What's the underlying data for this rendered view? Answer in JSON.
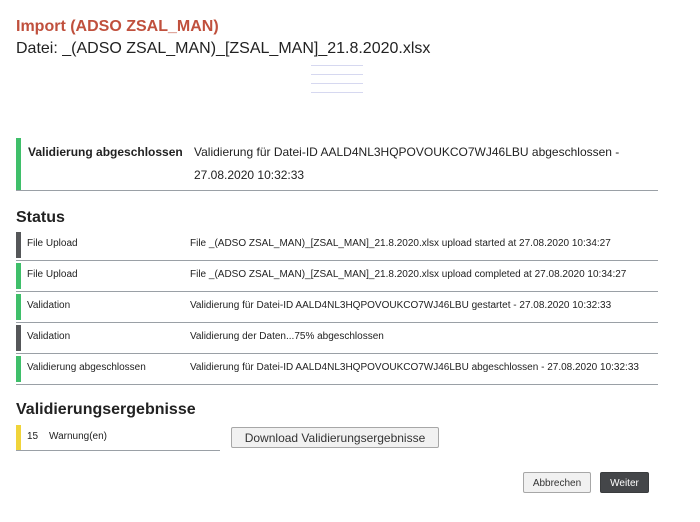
{
  "header": {
    "title": "Import  (ADSO ZSAL_MAN)",
    "filename": "Datei: _(ADSO ZSAL_MAN)_[ZSAL_MAN]_21.8.2020.xlsx"
  },
  "summary": {
    "label": "Validierung abgeschlossen",
    "message_line1": "Validierung für Datei-ID AALD4NL3HQPOVOUKCO7WJ46LBU abgeschlossen -",
    "message_line2": "27.08.2020 10:32:33",
    "bar_color": "#3fbf6a"
  },
  "status": {
    "heading": "Status",
    "rows": [
      {
        "type": "File Upload",
        "message": "File _(ADSO ZSAL_MAN)_[ZSAL_MAN]_21.8.2020.xlsx upload started at 27.08.2020 10:34:27",
        "color": "#555759"
      },
      {
        "type": "File Upload",
        "message": "File _(ADSO ZSAL_MAN)_[ZSAL_MAN]_21.8.2020.xlsx upload completed at 27.08.2020 10:34:27",
        "color": "#3fbf6a"
      },
      {
        "type": "Validation",
        "message": "Validierung für Datei-ID AALD4NL3HQPOVOUKCO7WJ46LBU gestartet - 27.08.2020 10:32:33",
        "color": "#3fbf6a"
      },
      {
        "type": "Validation",
        "message": "Validierung der Daten...75% abgeschlossen",
        "color": "#555759"
      },
      {
        "type": "Validierung abgeschlossen",
        "message": "Validierung für Datei-ID AALD4NL3HQPOVOUKCO7WJ46LBU abgeschlossen - 27.08.2020 10:32:33",
        "color": "#3fbf6a"
      }
    ]
  },
  "results": {
    "heading": "Validierungsergebnisse",
    "warning_count": "15",
    "warning_label": "Warnung(en)",
    "warning_color": "#f0d43a",
    "download_label": "Download Validierungsergebnisse"
  },
  "footer": {
    "cancel_label": "Abbrechen",
    "next_label": "Weiter"
  },
  "colors": {
    "title": "#c0503d",
    "success": "#3fbf6a",
    "neutral": "#555759",
    "warning": "#f0d43a",
    "primary_button": "#444649"
  }
}
